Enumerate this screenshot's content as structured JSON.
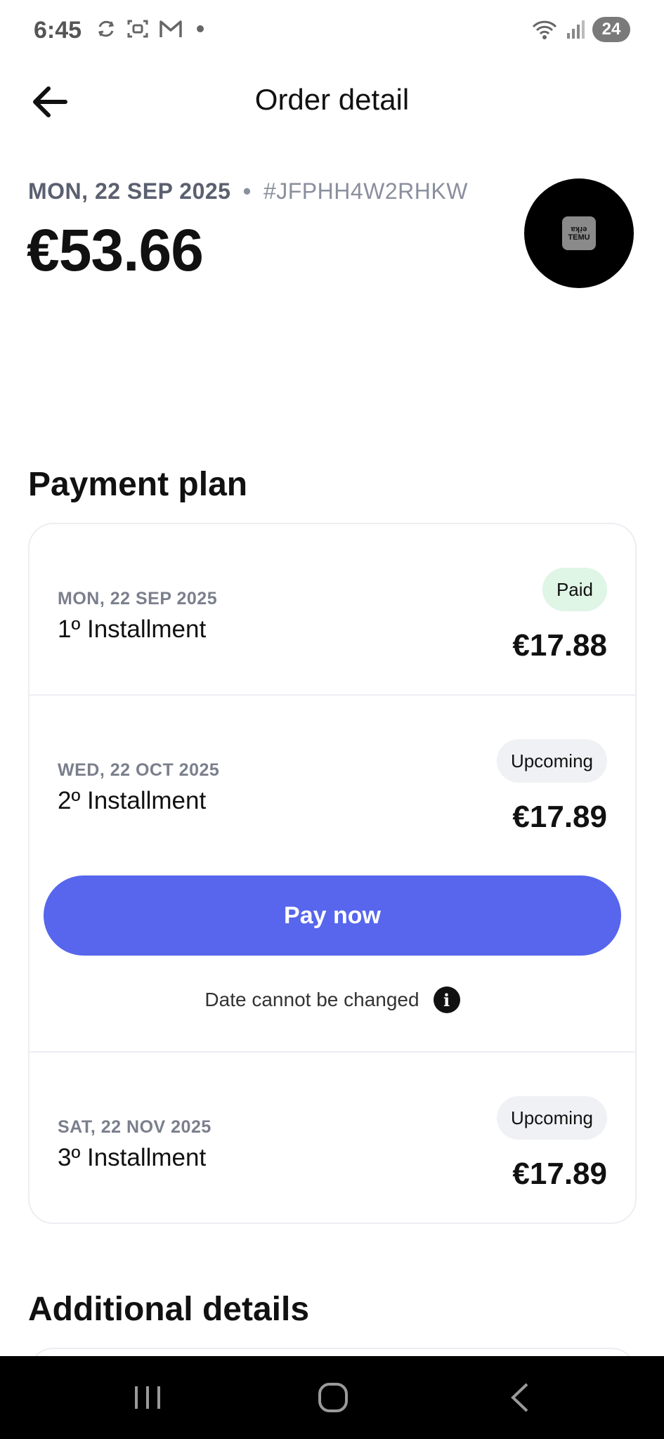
{
  "status_bar": {
    "time": "6:45",
    "battery": "24"
  },
  "header": {
    "title": "Order detail"
  },
  "order": {
    "date": "MON, 22 SEP 2025",
    "separator": "•",
    "reference": "#JFPHH4W2RHKW",
    "total": "€53.66",
    "merchant_logo_text_top": "ɐʞɹ̣ǝ",
    "merchant_logo_text_bottom": "TEMU"
  },
  "payment_plan": {
    "title": "Payment plan",
    "installments": [
      {
        "date": "MON, 22 SEP 2025",
        "label": "1º Installment",
        "status": "Paid",
        "amount": "€17.88"
      },
      {
        "date": "WED, 22 OCT 2025",
        "label": "2º Installment",
        "status": "Upcoming",
        "amount": "€17.89",
        "pay_button": "Pay now",
        "note": "Date cannot be changed"
      },
      {
        "date": "SAT, 22 NOV 2025",
        "label": "3º Installment",
        "status": "Upcoming",
        "amount": "€17.89"
      }
    ]
  },
  "additional": {
    "title": "Additional details"
  },
  "colors": {
    "accent": "#5766ec",
    "paid_badge": "#dff5e6",
    "upcoming_badge": "#f0f1f4"
  }
}
